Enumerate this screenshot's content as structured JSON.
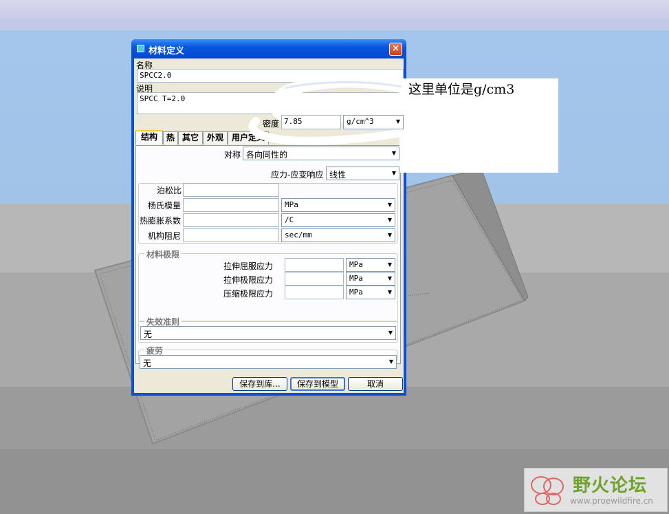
{
  "dialog": {
    "title": "材料定义",
    "close_label": "×",
    "name_label": "名称",
    "name_value": "SPCC2.0",
    "desc_label": "说明",
    "desc_value": "SPCC T=2.0",
    "density_label": "密度",
    "density_value": "7.85",
    "density_unit": "g/cm^3"
  },
  "tabs": [
    {
      "label": "结构",
      "active": true
    },
    {
      "label": "热",
      "active": false
    },
    {
      "label": "其它",
      "active": false
    },
    {
      "label": "外观",
      "active": false
    },
    {
      "label": "用户定义",
      "active": false
    }
  ],
  "structure": {
    "symmetry_label": "对称",
    "symmetry_value": "各向同性的",
    "stress_strain_label": "应力-应变响应",
    "stress_strain_value": "线性",
    "poisson_label": "泊松比",
    "poisson_value": "",
    "youngs_label": "杨氏模量",
    "youngs_value": "",
    "youngs_unit": "MPa",
    "thermal_label": "热膨胀系数",
    "thermal_value": "",
    "thermal_unit": "/C",
    "damping_label": "机构阻尼",
    "damping_value": "",
    "damping_unit": "sec/mm"
  },
  "limits": {
    "title": "材料极限",
    "tensile_yield_label": "拉伸屈服应力",
    "tensile_yield_unit": "MPa",
    "tensile_ultimate_label": "拉伸极限应力",
    "tensile_ultimate_unit": "MPa",
    "compressive_label": "压缩极限应力",
    "compressive_unit": "MPa"
  },
  "failure": {
    "title": "失效准则",
    "value": "无"
  },
  "fatigue": {
    "title": "疲劳",
    "value": "无"
  },
  "buttons": {
    "save_library": "保存到库...",
    "save_model": "保存到模型",
    "cancel": "取消"
  },
  "annotation": {
    "text": "这里单位是g/cm3"
  },
  "watermark": {
    "name": "野火论坛",
    "url": "www.proewildfire.cn"
  }
}
